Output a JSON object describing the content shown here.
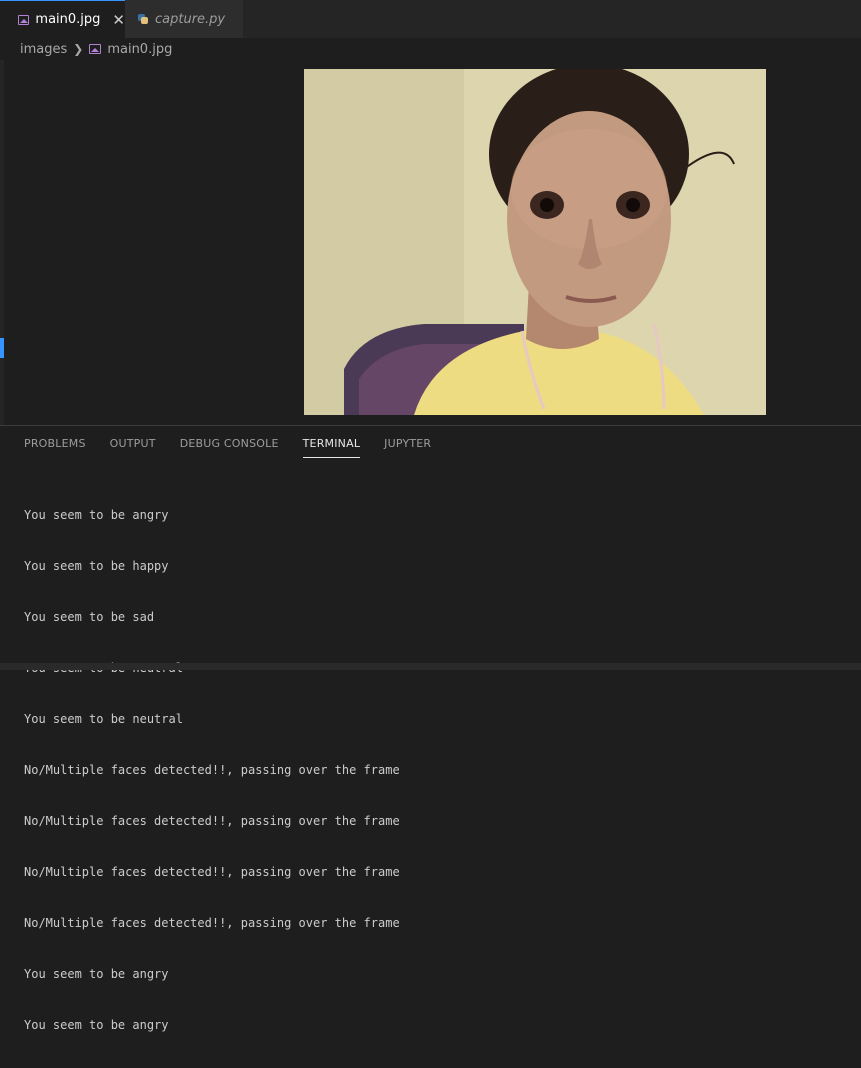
{
  "tabs": [
    {
      "label": "main0.jpg",
      "active": true,
      "icon": "image-icon"
    },
    {
      "label": "capture.py",
      "active": false,
      "icon": "python-icon"
    }
  ],
  "breadcrumb": {
    "folder": "images",
    "file": "main0.jpg"
  },
  "panel_tabs": [
    "PROBLEMS",
    "OUTPUT",
    "DEBUG CONSOLE",
    "TERMINAL",
    "JUPYTER"
  ],
  "terminal_lines": [
    "You seem to be angry",
    "You seem to be happy",
    "You seem to be sad",
    "You seem to be neutral",
    "You seem to be neutral",
    "No/Multiple faces detected!!, passing over the frame",
    "No/Multiple faces detected!!, passing over the frame",
    "No/Multiple faces detected!!, passing over the frame",
    "No/Multiple faces detected!!, passing over the frame",
    "You seem to be angry",
    "You seem to be angry"
  ],
  "colors": {
    "accent": "#3794ff",
    "image_icon": "#b180d7",
    "background": "#1e1e1e"
  }
}
